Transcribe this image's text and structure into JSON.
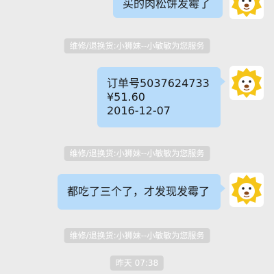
{
  "messages": [
    {
      "type": "outgoing",
      "lines": [
        "买的肉松饼发霉了"
      ]
    },
    {
      "type": "system",
      "text": "维修/退换货:小狮妹--小敏敏为您服务"
    },
    {
      "type": "outgoing",
      "lines": [
        "订单号5037624733",
        "¥51.60",
        "2016-12-07"
      ]
    },
    {
      "type": "system",
      "text": "维修/退换货:小狮妹--小敏敏为您服务"
    },
    {
      "type": "outgoing",
      "lines": [
        "都吃了三个了，才发现发霉了"
      ]
    },
    {
      "type": "system",
      "text": "维修/退换货:小狮妹--小敏敏为您服务"
    },
    {
      "type": "timestamp",
      "text": "昨天 07:38"
    }
  ],
  "avatar": {
    "icon": "lion-mascot-icon",
    "mane_color": "#f5c518",
    "face_color": "#ffffff"
  },
  "colors": {
    "background": "#ebebeb",
    "bubble": "#b8dcfa",
    "system_pill": "#d4d4d4"
  }
}
